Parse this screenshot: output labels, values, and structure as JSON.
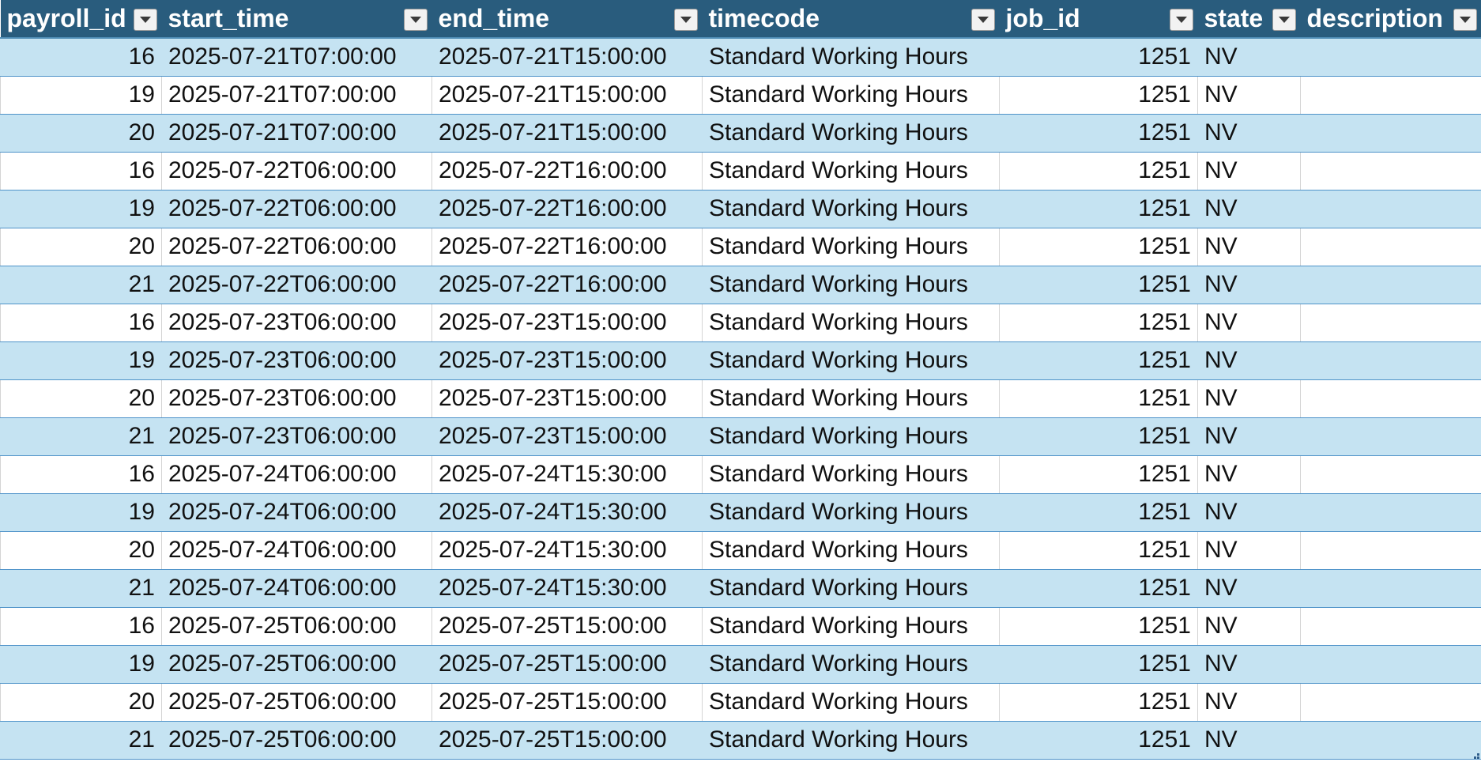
{
  "table": {
    "headers": [
      "payroll_id",
      "start_time",
      "end_time",
      "timecode",
      "job_id",
      "state",
      "description"
    ],
    "rows": [
      [
        "16",
        "2025-07-21T07:00:00",
        "2025-07-21T15:00:00",
        "Standard Working Hours",
        "1251",
        "NV",
        ""
      ],
      [
        "19",
        "2025-07-21T07:00:00",
        "2025-07-21T15:00:00",
        "Standard Working Hours",
        "1251",
        "NV",
        ""
      ],
      [
        "20",
        "2025-07-21T07:00:00",
        "2025-07-21T15:00:00",
        "Standard Working Hours",
        "1251",
        "NV",
        ""
      ],
      [
        "16",
        "2025-07-22T06:00:00",
        "2025-07-22T16:00:00",
        "Standard Working Hours",
        "1251",
        "NV",
        ""
      ],
      [
        "19",
        "2025-07-22T06:00:00",
        "2025-07-22T16:00:00",
        "Standard Working Hours",
        "1251",
        "NV",
        ""
      ],
      [
        "20",
        "2025-07-22T06:00:00",
        "2025-07-22T16:00:00",
        "Standard Working Hours",
        "1251",
        "NV",
        ""
      ],
      [
        "21",
        "2025-07-22T06:00:00",
        "2025-07-22T16:00:00",
        "Standard Working Hours",
        "1251",
        "NV",
        ""
      ],
      [
        "16",
        "2025-07-23T06:00:00",
        "2025-07-23T15:00:00",
        "Standard Working Hours",
        "1251",
        "NV",
        ""
      ],
      [
        "19",
        "2025-07-23T06:00:00",
        "2025-07-23T15:00:00",
        "Standard Working Hours",
        "1251",
        "NV",
        ""
      ],
      [
        "20",
        "2025-07-23T06:00:00",
        "2025-07-23T15:00:00",
        "Standard Working Hours",
        "1251",
        "NV",
        ""
      ],
      [
        "21",
        "2025-07-23T06:00:00",
        "2025-07-23T15:00:00",
        "Standard Working Hours",
        "1251",
        "NV",
        ""
      ],
      [
        "16",
        "2025-07-24T06:00:00",
        "2025-07-24T15:30:00",
        "Standard Working Hours",
        "1251",
        "NV",
        ""
      ],
      [
        "19",
        "2025-07-24T06:00:00",
        "2025-07-24T15:30:00",
        "Standard Working Hours",
        "1251",
        "NV",
        ""
      ],
      [
        "20",
        "2025-07-24T06:00:00",
        "2025-07-24T15:30:00",
        "Standard Working Hours",
        "1251",
        "NV",
        ""
      ],
      [
        "21",
        "2025-07-24T06:00:00",
        "2025-07-24T15:30:00",
        "Standard Working Hours",
        "1251",
        "NV",
        ""
      ],
      [
        "16",
        "2025-07-25T06:00:00",
        "2025-07-25T15:00:00",
        "Standard Working Hours",
        "1251",
        "NV",
        ""
      ],
      [
        "19",
        "2025-07-25T06:00:00",
        "2025-07-25T15:00:00",
        "Standard Working Hours",
        "1251",
        "NV",
        ""
      ],
      [
        "20",
        "2025-07-25T06:00:00",
        "2025-07-25T15:00:00",
        "Standard Working Hours",
        "1251",
        "NV",
        ""
      ],
      [
        "21",
        "2025-07-25T06:00:00",
        "2025-07-25T15:00:00",
        "Standard Working Hours",
        "1251",
        "NV",
        ""
      ]
    ]
  },
  "colors": {
    "header_bg": "#295c7d",
    "header_text": "#ffffff",
    "band_row": "#c5e3f2",
    "plain_row": "#ffffff",
    "row_border": "#4f93c9"
  },
  "icons": {
    "filter": "filter-dropdown-icon",
    "resize": "table-resize-handle-icon"
  }
}
